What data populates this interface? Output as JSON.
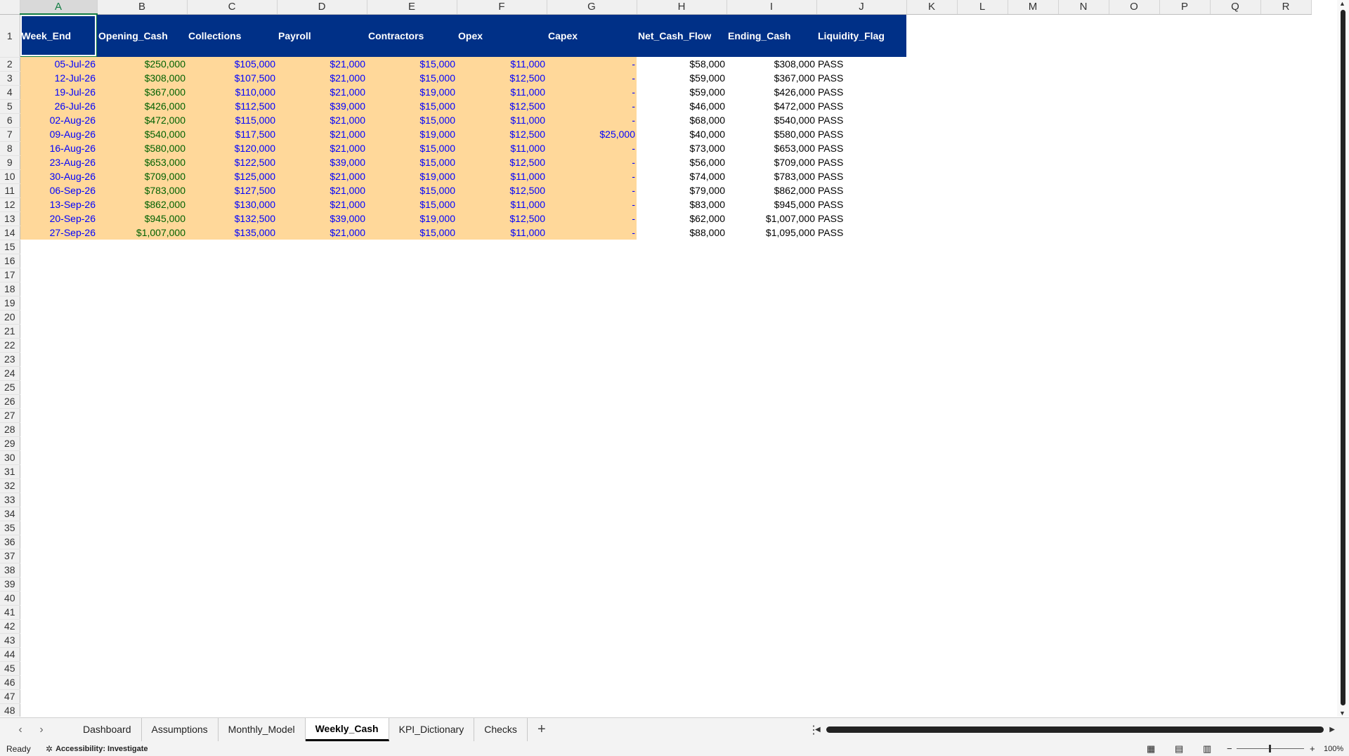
{
  "columns": [
    "A",
    "B",
    "C",
    "D",
    "E",
    "F",
    "G",
    "H",
    "I",
    "J",
    "K",
    "L",
    "M",
    "N",
    "O",
    "P",
    "Q",
    "R"
  ],
  "headers": [
    "Week_End",
    "Opening_Cash",
    "Collections",
    "Payroll",
    "Contractors",
    "Opex",
    "Capex",
    "Net_Cash_Flow",
    "Ending_Cash",
    "Liquidity_Flag"
  ],
  "rows": [
    [
      "05-Jul-26",
      "$250,000",
      "$105,000",
      "$21,000",
      "$15,000",
      "$11,000",
      "-",
      "$58,000",
      "$308,000",
      "PASS"
    ],
    [
      "12-Jul-26",
      "$308,000",
      "$107,500",
      "$21,000",
      "$15,000",
      "$12,500",
      "-",
      "$59,000",
      "$367,000",
      "PASS"
    ],
    [
      "19-Jul-26",
      "$367,000",
      "$110,000",
      "$21,000",
      "$19,000",
      "$11,000",
      "-",
      "$59,000",
      "$426,000",
      "PASS"
    ],
    [
      "26-Jul-26",
      "$426,000",
      "$112,500",
      "$39,000",
      "$15,000",
      "$12,500",
      "-",
      "$46,000",
      "$472,000",
      "PASS"
    ],
    [
      "02-Aug-26",
      "$472,000",
      "$115,000",
      "$21,000",
      "$15,000",
      "$11,000",
      "-",
      "$68,000",
      "$540,000",
      "PASS"
    ],
    [
      "09-Aug-26",
      "$540,000",
      "$117,500",
      "$21,000",
      "$19,000",
      "$12,500",
      "$25,000",
      "$40,000",
      "$580,000",
      "PASS"
    ],
    [
      "16-Aug-26",
      "$580,000",
      "$120,000",
      "$21,000",
      "$15,000",
      "$11,000",
      "-",
      "$73,000",
      "$653,000",
      "PASS"
    ],
    [
      "23-Aug-26",
      "$653,000",
      "$122,500",
      "$39,000",
      "$15,000",
      "$12,500",
      "-",
      "$56,000",
      "$709,000",
      "PASS"
    ],
    [
      "30-Aug-26",
      "$709,000",
      "$125,000",
      "$21,000",
      "$19,000",
      "$11,000",
      "-",
      "$74,000",
      "$783,000",
      "PASS"
    ],
    [
      "06-Sep-26",
      "$783,000",
      "$127,500",
      "$21,000",
      "$15,000",
      "$12,500",
      "-",
      "$79,000",
      "$862,000",
      "PASS"
    ],
    [
      "13-Sep-26",
      "$862,000",
      "$130,000",
      "$21,000",
      "$15,000",
      "$11,000",
      "-",
      "$83,000",
      "$945,000",
      "PASS"
    ],
    [
      "20-Sep-26",
      "$945,000",
      "$132,500",
      "$39,000",
      "$19,000",
      "$12,500",
      "-",
      "$62,000",
      "$1,007,000",
      "PASS"
    ],
    [
      "27-Sep-26",
      "$1,007,000",
      "$135,000",
      "$21,000",
      "$15,000",
      "$11,000",
      "-",
      "$88,000",
      "$1,095,000",
      "PASS"
    ]
  ],
  "sheet_tabs": [
    "Dashboard",
    "Assumptions",
    "Monthly_Model",
    "Weekly_Cash",
    "KPI_Dictionary",
    "Checks"
  ],
  "active_sheet": "Weekly_Cash",
  "status": {
    "ready": "Ready",
    "accessibility": "Accessibility: Investigate",
    "zoom": "100%"
  },
  "icons": {
    "prev": "chevron-left",
    "next": "chevron-right",
    "add": "plus",
    "more": "vertical-ellipsis"
  },
  "colors": {
    "header_bg": "#003087",
    "input_fill": "#ffd89a",
    "input_blue": "#0000ff",
    "input_green": "#006100"
  }
}
